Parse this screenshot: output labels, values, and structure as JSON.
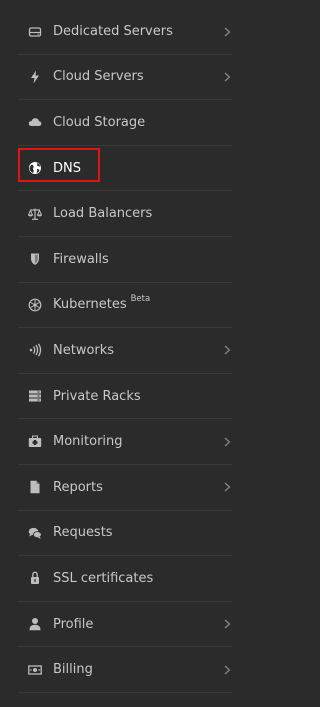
{
  "sidebar": {
    "items": [
      {
        "label": "Dedicated Servers",
        "icon": "server-icon",
        "has_submenu": true
      },
      {
        "label": "Cloud Servers",
        "icon": "bolt-icon",
        "has_submenu": true
      },
      {
        "label": "Cloud Storage",
        "icon": "cloud-icon",
        "has_submenu": false
      },
      {
        "label": "DNS",
        "icon": "globe-icon",
        "has_submenu": false,
        "selected": true
      },
      {
        "label": "Load Balancers",
        "icon": "scale-icon",
        "has_submenu": false
      },
      {
        "label": "Firewalls",
        "icon": "shield-icon",
        "has_submenu": false
      },
      {
        "label": "Kubernetes",
        "icon": "helm-icon",
        "has_submenu": false,
        "badge": "Beta"
      },
      {
        "label": "Networks",
        "icon": "signal-icon",
        "has_submenu": true
      },
      {
        "label": "Private Racks",
        "icon": "rack-icon",
        "has_submenu": false
      },
      {
        "label": "Monitoring",
        "icon": "monitor-icon",
        "has_submenu": true
      },
      {
        "label": "Reports",
        "icon": "document-icon",
        "has_submenu": true
      },
      {
        "label": "Requests",
        "icon": "chat-icon",
        "has_submenu": false
      },
      {
        "label": "SSL certificates",
        "icon": "certificate-icon",
        "has_submenu": false
      },
      {
        "label": "Profile",
        "icon": "user-icon",
        "has_submenu": true
      },
      {
        "label": "Billing",
        "icon": "money-icon",
        "has_submenu": true
      }
    ]
  },
  "colors": {
    "background": "#2b2b2b",
    "divider": "#3a3a3a",
    "text": "#c8c8c8",
    "icon": "#bdbdbd",
    "highlight": "#e01515"
  }
}
